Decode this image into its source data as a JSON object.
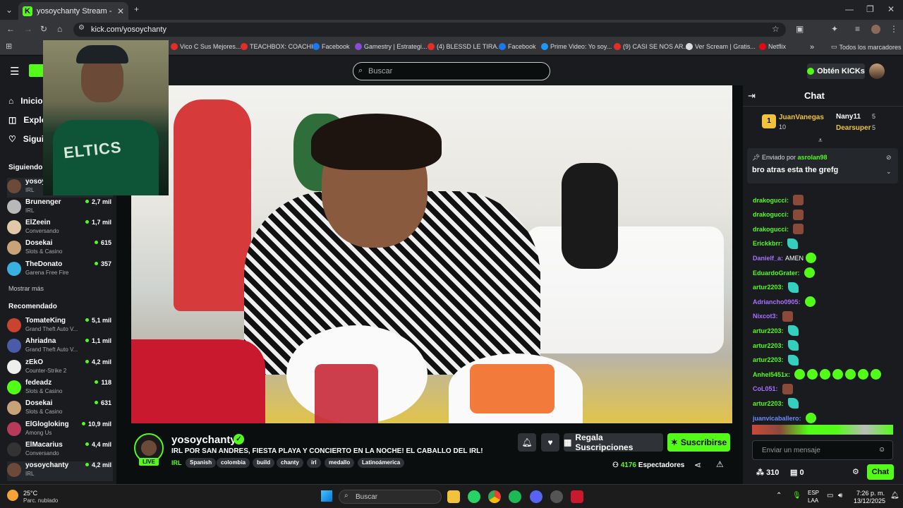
{
  "browser": {
    "tab_title": "yosoychanty Stream - Watc",
    "url": "kick.com/yosoychanty",
    "bookmarks": [
      "Vico C Sus Mejores...",
      "TEACHBOX: COACHI...",
      "Facebook",
      "Gamestry | Estrategi...",
      "(4) BLESSD LE TIRA...",
      "Facebook",
      "Prime Video: Yo soy...",
      "(9) CASI SE NOS AR...",
      "Ver Scream | Gratis...",
      "Netflix",
      "Todos los marcadores"
    ]
  },
  "header": {
    "search_placeholder": "Buscar",
    "kicks_button": "Obtén KICKs"
  },
  "sidebar": {
    "nav": [
      "Inicio",
      "Explorar",
      "Siguiendo"
    ],
    "following_title": "Siguiendo",
    "following": [
      {
        "name": "yosoychanty",
        "category": "IRL",
        "viewers": ""
      },
      {
        "name": "Brunenger",
        "category": "IRL",
        "viewers": "2,7 mil"
      },
      {
        "name": "ElZeein",
        "category": "Conversando",
        "viewers": "1,7 mil"
      },
      {
        "name": "Dosekai",
        "category": "Slots & Casino",
        "viewers": "615"
      },
      {
        "name": "TheDonato",
        "category": "Garena Free Fire",
        "viewers": "357"
      }
    ],
    "show_more": "Mostrar más",
    "recommended_title": "Recomendado",
    "recommended": [
      {
        "name": "TomateKing",
        "category": "Grand Theft Auto V...",
        "viewers": "5,1 mil",
        "color": "#c9442f"
      },
      {
        "name": "Ahriadna",
        "category": "Grand Theft Auto V...",
        "viewers": "1,1 mil",
        "color": "#4a5ba8"
      },
      {
        "name": "zEkO",
        "category": "Counter-Strike 2",
        "viewers": "4,2 mil",
        "color": "#eeeeee"
      },
      {
        "name": "fedeadz",
        "category": "Slots & Casino",
        "viewers": "118",
        "color": "#53fc18"
      },
      {
        "name": "Dosekai",
        "category": "Slots & Casino",
        "viewers": "631",
        "color": "#c8a37a"
      },
      {
        "name": "ElGlogloking",
        "category": "Among Us",
        "viewers": "10,9 mil",
        "color": "#b83a5a"
      },
      {
        "name": "ElMacarius",
        "category": "Conversando",
        "viewers": "4,4 mil",
        "color": "#333333"
      },
      {
        "name": "yosoychanty",
        "category": "IRL",
        "viewers": "4,2 mil",
        "color": "#6b4a38"
      }
    ]
  },
  "webcam": {
    "shirt_text": "ELTICS"
  },
  "stream": {
    "channel": "yosoychanty",
    "live_label": "LIVE",
    "title": "IRL POR SAN ANDRES, FIESTA PLAYA Y CONCIERTO EN LA NOCHE! EL CABALLO DEL IRL!",
    "category": "IRL",
    "tags": [
      "Spanish",
      "colombia",
      "build",
      "chanty",
      "irl",
      "medallo",
      "Latinoámerica"
    ],
    "gift_button": "Regala Suscripciones",
    "subscribe_button": "Suscribirse",
    "viewer_count": "4176",
    "viewer_label": "Espectadores"
  },
  "chat": {
    "title": "Chat",
    "gifters": [
      {
        "rank": "1",
        "name": "JuanVanegas",
        "count": "10"
      },
      {
        "name": "Nany11",
        "count": "5"
      },
      {
        "name": "Dearsuper",
        "count": "5"
      }
    ],
    "pinned_label": "Enviado por",
    "pinned_user": "asrolan98",
    "pinned_message": "bro atras esta the grefg",
    "messages": [
      {
        "user": "drakogucci:",
        "color": "#53fc18",
        "text": "",
        "emotes": [
          "b"
        ]
      },
      {
        "user": "drakogucci:",
        "color": "#53fc18",
        "text": "",
        "emotes": [
          "b"
        ]
      },
      {
        "user": "drakogucci:",
        "color": "#53fc18",
        "text": "",
        "emotes": [
          "b"
        ]
      },
      {
        "user": "Erickkbrr:",
        "color": "#53fc18",
        "text": "",
        "emotes": [
          "c"
        ]
      },
      {
        "user": "Danielf_a:",
        "color": "#a970ff",
        "text": "AMEN",
        "emotes": [
          "g"
        ]
      },
      {
        "user": "EduardoGrater:",
        "color": "#53fc18",
        "text": "",
        "emotes": [
          "g"
        ]
      },
      {
        "user": "artur2203:",
        "color": "#53fc18",
        "text": "",
        "emotes": [
          "c"
        ]
      },
      {
        "user": "Adriancho0905:",
        "color": "#a970ff",
        "text": "",
        "emotes": [
          "g"
        ]
      },
      {
        "user": "Nixcot3:",
        "color": "#a970ff",
        "text": "",
        "emotes": [
          "b"
        ]
      },
      {
        "user": "artur2203:",
        "color": "#53fc18",
        "text": "",
        "emotes": [
          "c"
        ]
      },
      {
        "user": "artur2203:",
        "color": "#53fc18",
        "text": "",
        "emotes": [
          "c"
        ]
      },
      {
        "user": "artur2203:",
        "color": "#53fc18",
        "text": "",
        "emotes": [
          "c"
        ]
      },
      {
        "user": "Anhel5451x:",
        "color": "#53fc18",
        "text": "",
        "emotes": [
          "g",
          "g",
          "g",
          "g",
          "g",
          "g",
          "g"
        ]
      },
      {
        "user": "CoL051:",
        "color": "#a970ff",
        "text": "",
        "emotes": [
          "b"
        ]
      },
      {
        "user": "artur2203:",
        "color": "#53fc18",
        "text": "",
        "emotes": [
          "c"
        ]
      },
      {
        "user": "juanvicaballero:",
        "color": "#6b8cff",
        "text": "",
        "emotes": [
          "g"
        ]
      }
    ],
    "input_placeholder": "Enviar un mensaje",
    "points": "310",
    "store_count": "0",
    "send_button": "Chat"
  },
  "taskbar": {
    "temperature": "25°C",
    "weather": "Parc. nublado",
    "search": "Buscar",
    "lang1": "ESP",
    "lang2": "LAA",
    "time": "7:26 p. m.",
    "date": "13/12/2025"
  }
}
